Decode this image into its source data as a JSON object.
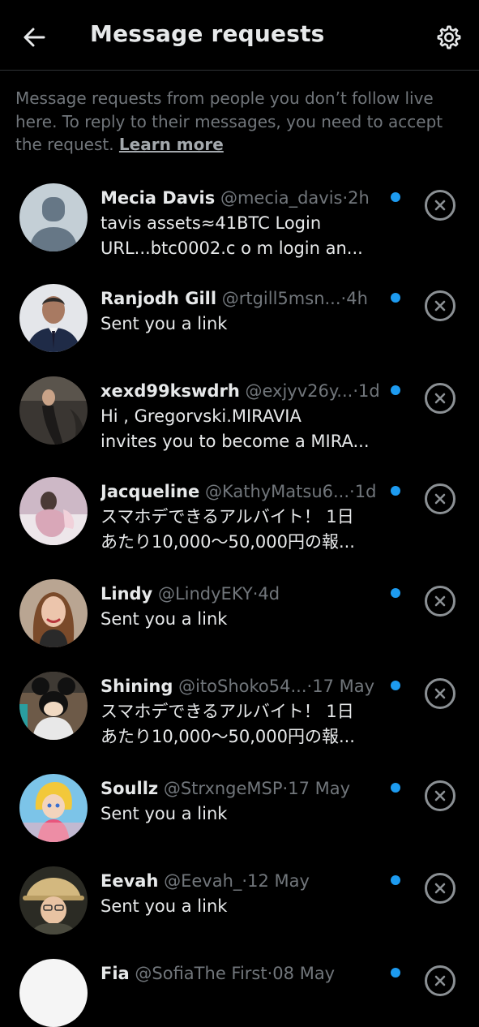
{
  "header": {
    "title": "Message requests",
    "back_icon": "arrow-left-icon",
    "settings_icon": "gear-icon"
  },
  "info": {
    "text": "Message requests from people you don’t follow live here. To reply to their messages, you need to accept the request. ",
    "link": "Learn more"
  },
  "colors": {
    "background": "#000000",
    "primary_text": "#e7e9ea",
    "secondary_text": "#71767b",
    "unread_dot": "#1d9bf0",
    "divider": "#2f3336"
  },
  "requests": [
    {
      "name": "Mecia  Davis",
      "handle": "@mecia_davis",
      "time": "2h",
      "preview_line1": "tavis assets≈41BTC Login",
      "preview_line2": "URL...btc0002.c o m login an...",
      "unread": true
    },
    {
      "name": "Ranjodh Gill",
      "handle": "@rtgill5msn...",
      "time": "4h",
      "preview_line1": "Sent you a link",
      "preview_line2": "",
      "unread": true
    },
    {
      "name": "xexd99kswdrh",
      "handle": "@exjyv26y...",
      "time": "1d",
      "preview_line1": "Hi , Gregorvski.MIRAVIA",
      "preview_line2": "invites you to become a MIRA...",
      "unread": true
    },
    {
      "name": "Jacqueline",
      "handle": "@KathyMatsu6...",
      "time": "1d",
      "preview_line1": "スマホデできるアルバイト！ 1日",
      "preview_line2": "あたり10,000〜50,000円の報...",
      "unread": true
    },
    {
      "name": "Lindy",
      "handle": "@LindyEKY",
      "time": "4d",
      "preview_line1": "Sent you a link",
      "preview_line2": "",
      "unread": true
    },
    {
      "name": "Shining",
      "handle": "@itoShoko54...",
      "time": "17 May",
      "preview_line1": "スマホデできるアルバイト！ 1日",
      "preview_line2": "あたり10,000〜50,000円の報...",
      "unread": true
    },
    {
      "name": "Soullz",
      "handle": "@StrxngeMSP",
      "time": "17 May",
      "preview_line1": "Sent you a link",
      "preview_line2": "",
      "unread": true
    },
    {
      "name": "Eevah",
      "handle": "@Eevah_",
      "time": "12 May",
      "preview_line1": "Sent you a link",
      "preview_line2": "",
      "unread": true
    },
    {
      "name": "Fia",
      "handle": "@SofiaThe First",
      "time": "08 May",
      "preview_line1": "",
      "preview_line2": "",
      "unread": true
    }
  ],
  "sep": "·"
}
